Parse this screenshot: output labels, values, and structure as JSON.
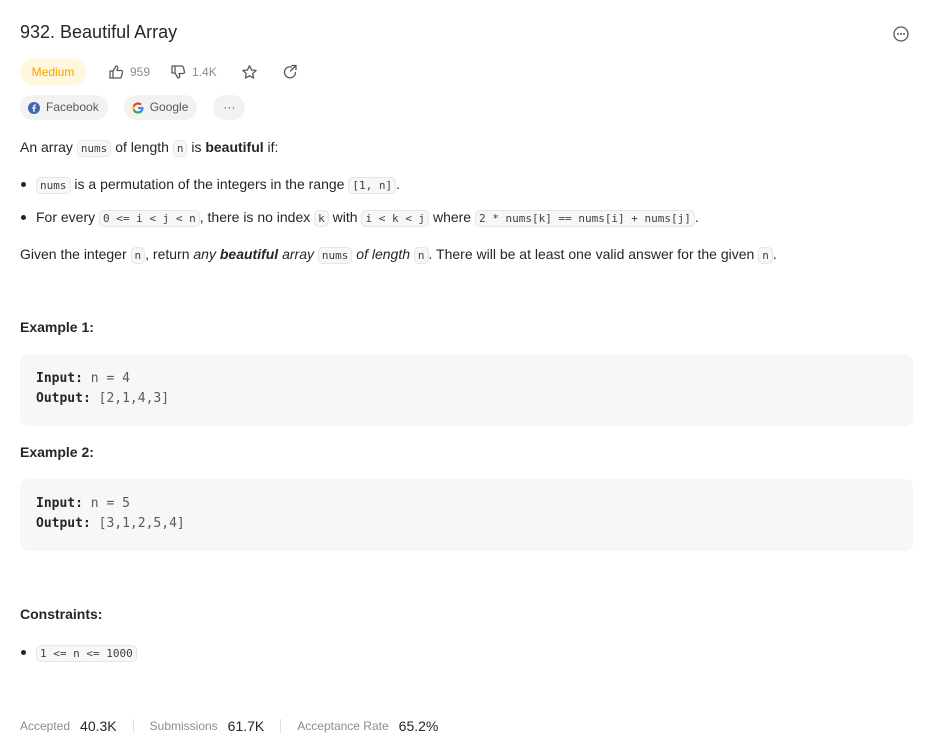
{
  "problem": {
    "title": "932. Beautiful Array",
    "difficulty": "Medium",
    "likes": "959",
    "dislikes": "1.4K"
  },
  "tags": {
    "company1": "Facebook",
    "company2": "Google",
    "more": "···"
  },
  "description": {
    "p1": {
      "t1": "An array ",
      "c1": "nums",
      "t2": " of length ",
      "c2": "n",
      "t3": " is ",
      "b1": "beautiful",
      "t4": " if:"
    },
    "bullet1": {
      "c1": "nums",
      "t1": " is a permutation of the integers in the range ",
      "c2": "[1, n]",
      "t2": "."
    },
    "bullet2": {
      "t1": "For every ",
      "c1": "0 <= i < j < n",
      "t2": ", there is no index ",
      "c2": "k",
      "t3": " with ",
      "c3": "i < k < j",
      "t4": " where ",
      "c4": "2 * nums[k] == nums[i] + nums[j]",
      "t5": "."
    },
    "p2": {
      "t1": "Given the integer ",
      "c1": "n",
      "t2": ", return ",
      "i1": "any ",
      "ib1": "beautiful",
      "i2": " array",
      "t3": " ",
      "c2": "nums",
      "t4": " ",
      "i3": "of length",
      "t5": " ",
      "c3": "n",
      "t6": ". There will be at least one valid answer for the given ",
      "c4": "n",
      "t7": "."
    }
  },
  "examples": [
    {
      "title": "Example 1:",
      "input_label": "Input:",
      "input": " n = 4",
      "output_label": "Output:",
      "output": " [2,1,4,3]"
    },
    {
      "title": "Example 2:",
      "input_label": "Input:",
      "input": " n = 5",
      "output_label": "Output:",
      "output": " [3,1,2,5,4]"
    }
  ],
  "constraints": {
    "title": "Constraints:",
    "items": [
      "1 <= n <= 1000"
    ]
  },
  "stats": {
    "accepted_label": "Accepted",
    "accepted": "40.3K",
    "submissions_label": "Submissions",
    "submissions": "61.7K",
    "rate_label": "Acceptance Rate",
    "rate": "65.2%"
  },
  "colors": {
    "medium_text": "#f2a100",
    "medium_bg": "#fff6dc",
    "facebook_blue": "#4267b2"
  },
  "icons": {
    "more": "more-circle-icon",
    "like": "thumbs-up-icon",
    "dislike": "thumbs-down-icon",
    "favorite": "star-icon",
    "share": "share-icon",
    "facebook": "facebook-icon",
    "google": "google-icon"
  }
}
